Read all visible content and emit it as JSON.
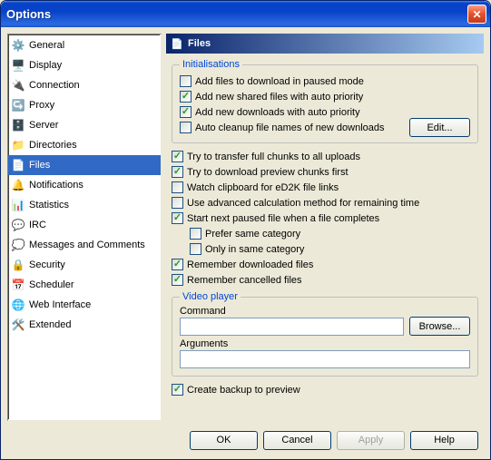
{
  "title": "Options",
  "sidebar": {
    "items": [
      {
        "label": "General",
        "glyph": "⚙️"
      },
      {
        "label": "Display",
        "glyph": "🖥️"
      },
      {
        "label": "Connection",
        "glyph": "🔌"
      },
      {
        "label": "Proxy",
        "glyph": "↪️"
      },
      {
        "label": "Server",
        "glyph": "🗄️"
      },
      {
        "label": "Directories",
        "glyph": "📁"
      },
      {
        "label": "Files",
        "glyph": "📄"
      },
      {
        "label": "Notifications",
        "glyph": "🔔"
      },
      {
        "label": "Statistics",
        "glyph": "📊"
      },
      {
        "label": "IRC",
        "glyph": "💬"
      },
      {
        "label": "Messages and Comments",
        "glyph": "💭"
      },
      {
        "label": "Security",
        "glyph": "🔒"
      },
      {
        "label": "Scheduler",
        "glyph": "📅"
      },
      {
        "label": "Web Interface",
        "glyph": "🌐"
      },
      {
        "label": "Extended",
        "glyph": "🛠️"
      }
    ],
    "active_index": 6
  },
  "header": {
    "title": "Files",
    "glyph": "📄"
  },
  "groups": {
    "init": {
      "legend": "Initialisations",
      "c1": "Add files to download in paused mode",
      "c2": "Add new shared files with auto priority",
      "c3": "Add new downloads with auto priority",
      "c4": "Auto cleanup file names of new downloads",
      "edit_btn": "Edit..."
    },
    "mid": {
      "c1": "Try to transfer full chunks to all uploads",
      "c2": "Try to download preview chunks first",
      "c3": "Watch clipboard for eD2K file links",
      "c4": "Use advanced calculation method for remaining time",
      "c5": "Start next paused file when a file completes",
      "c5a": "Prefer same category",
      "c5b": "Only in same category",
      "c6": "Remember downloaded files",
      "c7": "Remember cancelled files"
    },
    "vp": {
      "legend": "Video player",
      "cmd_label": "Command",
      "args_label": "Arguments",
      "cmd_value": "",
      "args_value": "",
      "browse": "Browse..."
    },
    "backup": "Create backup to preview"
  },
  "buttons": {
    "ok": "OK",
    "cancel": "Cancel",
    "apply": "Apply",
    "help": "Help"
  }
}
